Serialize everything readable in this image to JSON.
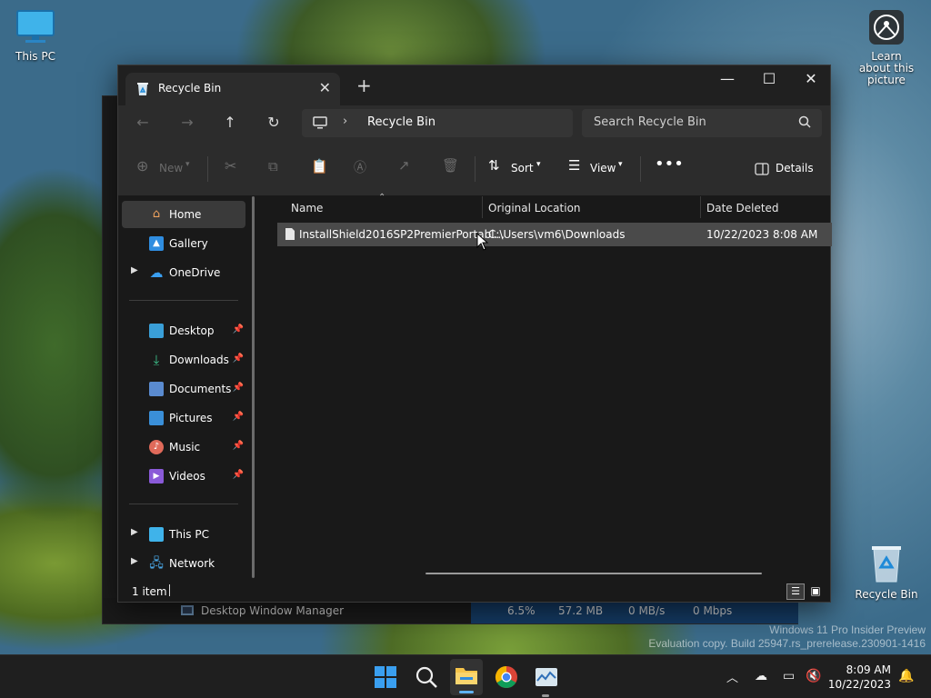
{
  "desktop": {
    "this_pc_label": "This PC",
    "learn_label": "Learn about this picture",
    "recycle_label": "Recycle Bin",
    "watermark_line1": "Windows 11 Pro Insider Preview",
    "watermark_line2": "Evaluation copy. Build 25947.rs_prerelease.230901-1416"
  },
  "taskmanager_row": {
    "name": "Desktop Window Manager",
    "cpu": "6.5%",
    "memory": "57.2 MB",
    "disk": "0 MB/s",
    "network": "0 Mbps"
  },
  "explorer": {
    "tab_title": "Recycle Bin",
    "address_crumb": "Recycle Bin",
    "search_placeholder": "Search Recycle Bin",
    "toolbar": {
      "new_label": "New",
      "sort_label": "Sort",
      "view_label": "View",
      "details_label": "Details"
    },
    "nav": [
      {
        "label": "Home"
      },
      {
        "label": "Gallery"
      },
      {
        "label": "OneDrive"
      },
      {
        "label": "Desktop"
      },
      {
        "label": "Downloads"
      },
      {
        "label": "Documents"
      },
      {
        "label": "Pictures"
      },
      {
        "label": "Music"
      },
      {
        "label": "Videos"
      },
      {
        "label": "This PC"
      },
      {
        "label": "Network"
      }
    ],
    "columns": {
      "name": "Name",
      "original_location": "Original Location",
      "date_deleted": "Date Deleted"
    },
    "files": [
      {
        "name": "InstallShield2016SP2PremierPortabl...",
        "original_location": "C:\\Users\\vm6\\Downloads",
        "date_deleted": "10/22/2023 8:08 AM"
      }
    ],
    "status": "1 item"
  },
  "clock": {
    "time": "8:09 AM",
    "date": "10/22/2023"
  },
  "colors": {
    "accent": "#0078d4",
    "selection": "#4a4a4a",
    "taskbar": "#1f1f1f"
  }
}
